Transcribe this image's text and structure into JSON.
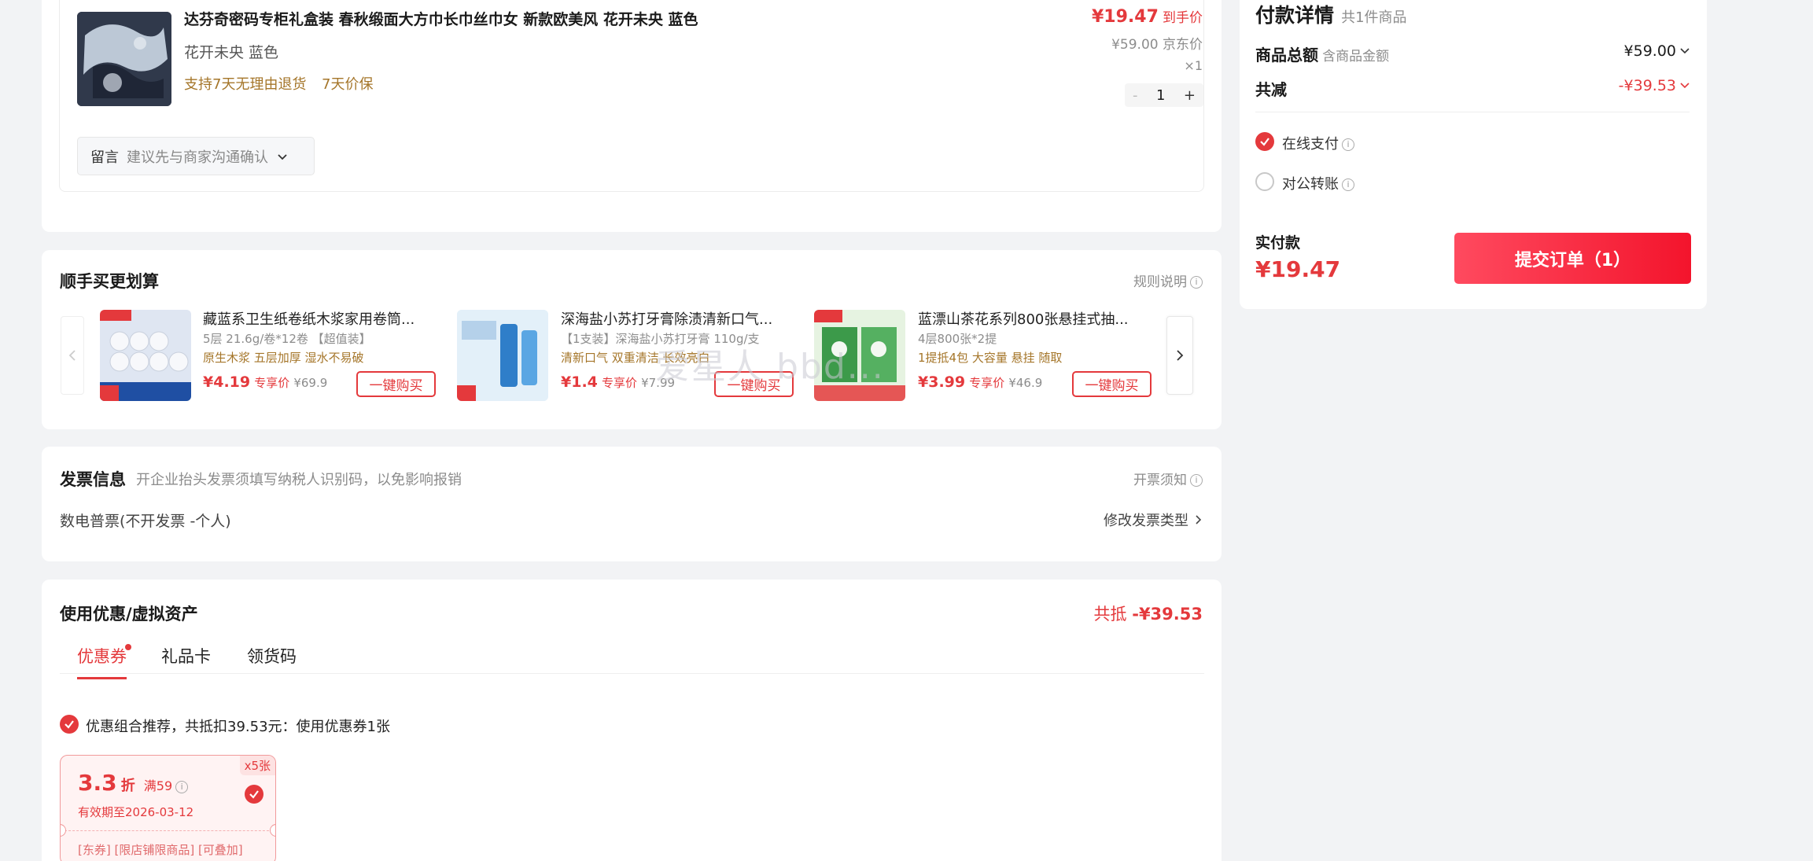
{
  "product": {
    "title": "达芬奇密码专柜礼盒装 春秋缎面大方巾长巾丝巾女 新款欧美风 花开未央 蓝色",
    "variant": "花开未央 蓝色",
    "service1": "支持7天无理由退货",
    "service2": "7天价保",
    "price": "¥19.47",
    "price_label": "到手价",
    "jd_price": "¥59.00",
    "jd_price_label": "京东价",
    "qty_label": "×1",
    "qty": "1",
    "minus": "-",
    "plus": "+",
    "message_label": "留言",
    "message_placeholder": "建议先与商家沟通确认"
  },
  "addon": {
    "title": "顺手买更划算",
    "rules": "规则说明",
    "buy_label": "一键购买",
    "member_label": "专享价",
    "items": [
      {
        "name": "藏蓝系卫生纸卷纸木浆家用卷筒...",
        "spec": "5层 21.6g/卷*12卷 【超值装】",
        "tags": "原生木浆 五层加厚 湿水不易破",
        "price": "¥4.19",
        "orig": "¥69.9"
      },
      {
        "name": "深海盐小苏打牙膏除渍清新口气...",
        "spec": "【1支装】深海盐小苏打牙膏 110g/支",
        "tags": "清新口气 双重清洁 长效亮白",
        "price": "¥1.4",
        "orig": "¥7.99"
      },
      {
        "name": "蓝漂山茶花系列800张悬挂式抽...",
        "spec": "4层800张*2提",
        "tags": "1提抵4包 大容量 悬挂 随取",
        "price": "¥3.99",
        "orig": "¥46.9"
      }
    ]
  },
  "invoice": {
    "title": "发票信息",
    "hint": "开企业抬头发票须填写纳税人识别码，以免影响报销",
    "notice": "开票须知",
    "type": "数电普票(不开发票 -个人)",
    "modify": "修改发票类型"
  },
  "coupon": {
    "title": "使用优惠/虚拟资产",
    "total_label": "共抵",
    "total_value": "-¥39.53",
    "tabs": [
      "优惠券",
      "礼品卡",
      "领货码"
    ],
    "recommend": "优惠组合推荐，共抵扣39.53元：使用优惠券1张",
    "card": {
      "count": "x5张",
      "discount": "3.3",
      "discount_unit": "折",
      "threshold": "满59",
      "expiry": "有效期至2026-03-12",
      "tags": "[东券] [限店铺限商品] [可叠加]"
    }
  },
  "payment": {
    "title": "付款详情",
    "count": "共1件商品",
    "goods_total_label": "商品总额",
    "goods_total_hint": "含商品金额",
    "goods_total_value": "¥59.00",
    "discount_label": "共减",
    "discount_value": "-¥39.53",
    "online_pay": "在线支付",
    "corporate": "对公转账",
    "actual_label": "实付款",
    "actual_value": "¥19.47",
    "submit": "提交订单（1）"
  },
  "watermark": "爱星人 bbd..."
}
